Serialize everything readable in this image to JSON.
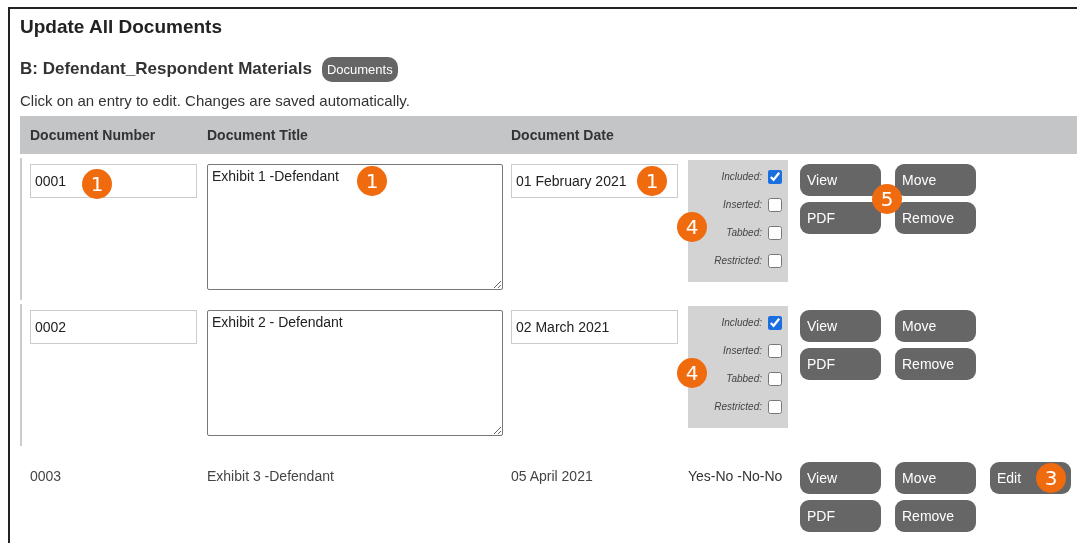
{
  "title": "Update All Documents",
  "section": {
    "title": "B: Defendant_Respondent Materials",
    "badge": "Documents"
  },
  "instructions": "Click on an entry to edit. Changes are saved automatically.",
  "table": {
    "columns": [
      "Document Number",
      "Document Title",
      "Document Date"
    ],
    "rows": [
      {
        "kind": "edit",
        "number": {
          "value": "0001",
          "callout": "1"
        },
        "title": {
          "value": "Exhibit 1 -Defendant",
          "callout": "1"
        },
        "date": {
          "value": "01 February 2021",
          "callout": "1"
        },
        "flags_callout": "4",
        "flags": [
          {
            "label": "Included:",
            "checked": true
          },
          {
            "label": "Inserted:",
            "checked": false
          },
          {
            "label": "Tabbed:",
            "checked": false
          },
          {
            "label": "Restricted:",
            "checked": false
          }
        ],
        "buttons_callout": "5",
        "buttons": [
          {
            "label": "View"
          },
          {
            "label": "Move"
          },
          {
            "label": "PDF"
          },
          {
            "label": "Remove"
          }
        ]
      },
      {
        "kind": "edit",
        "number": {
          "value": "0002"
        },
        "title": {
          "value": "Exhibit 2 - Defendant"
        },
        "date": {
          "value": "02 March 2021"
        },
        "flags_callout": "4",
        "flags": [
          {
            "label": "Included:",
            "checked": true
          },
          {
            "label": "Inserted:",
            "checked": false
          },
          {
            "label": "Tabbed:",
            "checked": false
          },
          {
            "label": "Restricted:",
            "checked": false
          }
        ],
        "buttons": [
          {
            "label": "View"
          },
          {
            "label": "Move"
          },
          {
            "label": "PDF"
          },
          {
            "label": "Remove"
          }
        ]
      },
      {
        "kind": "display",
        "number": {
          "value": "0003"
        },
        "title": {
          "value": "Exhibit 3 -Defendant"
        },
        "date": {
          "value": "05 April 2021"
        },
        "flags_summary": "Yes-No -No-No",
        "buttons": [
          {
            "label": "View"
          },
          {
            "label": "Move"
          },
          {
            "label": "PDF"
          },
          {
            "label": "Remove"
          }
        ],
        "edit_button": {
          "label": "Edit",
          "callout": "3"
        }
      }
    ]
  }
}
